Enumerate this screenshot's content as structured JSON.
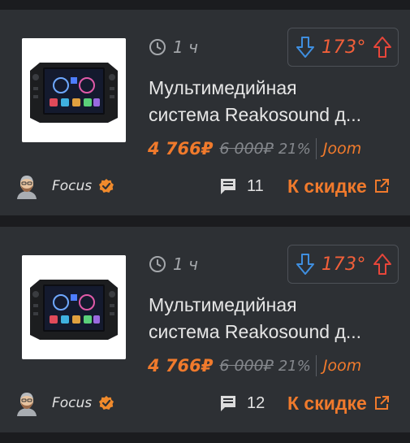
{
  "colors": {
    "background": "#1b1c1f",
    "card": "#2d3034",
    "accent": "#f07a2c",
    "temperature": "#f25f3a",
    "vote_down": "#3f8fe0",
    "vote_up": "#e8463a",
    "muted": "#84878c",
    "verified": "#f08a2c"
  },
  "deals": [
    {
      "time": "1 ч",
      "temperature": "173°",
      "title_line1": "Мультимедийная",
      "title_line2": "система Reakosound д...",
      "price": "4 766₽",
      "old_price": "6 000₽",
      "discount": "21%",
      "store": "Joom",
      "username": "Focus",
      "comments": "11",
      "deal_link": "К скидке",
      "icons": [
        "clock-icon",
        "arrow-down-icon",
        "arrow-up-icon",
        "verified-icon",
        "comment-icon",
        "external-link-icon"
      ]
    },
    {
      "time": "1 ч",
      "temperature": "173°",
      "title_line1": "Мультимедийная",
      "title_line2": "система Reakosound д...",
      "price": "4 766₽",
      "old_price": "6 000₽",
      "discount": "21%",
      "store": "Joom",
      "username": "Focus",
      "comments": "12",
      "deal_link": "К скидке",
      "icons": [
        "clock-icon",
        "arrow-down-icon",
        "arrow-up-icon",
        "verified-icon",
        "comment-icon",
        "external-link-icon"
      ]
    }
  ]
}
